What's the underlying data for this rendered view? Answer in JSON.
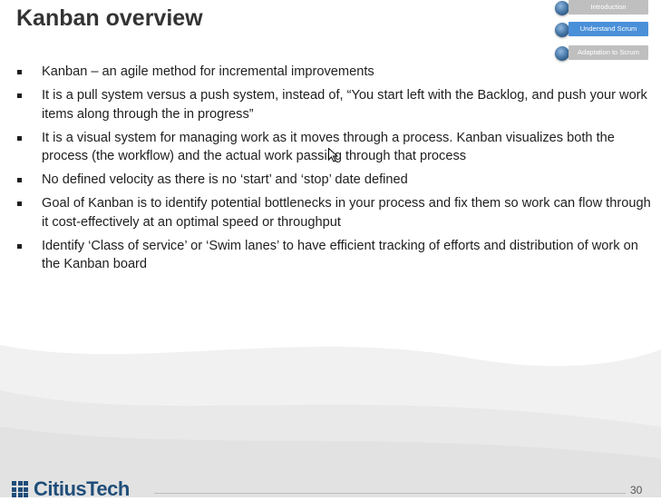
{
  "slide": {
    "title": "Kanban overview",
    "page_number": "30"
  },
  "nav": {
    "items": [
      {
        "label": "Introduction",
        "active": false
      },
      {
        "label": "Understand Scrum",
        "active": true
      },
      {
        "label": "Adaptation to Scrum",
        "active": false
      }
    ]
  },
  "bullets": [
    "Kanban – an agile method for incremental improvements",
    "It is a pull system versus a push system, instead of, “You start left with the Backlog, and push your work items along through the in progress”",
    "It is a visual system for managing work as it moves through a process. Kanban visualizes both the process (the workflow) and the actual work passing through that process",
    "No defined velocity as there is no ‘start’ and ‘stop’ date defined",
    "Goal of Kanban is to identify potential bottlenecks in your process and fix them so work can flow through it cost-effectively at an optimal speed or throughput",
    "Identify ‘Class of service’ or ‘Swim lanes’ to have efficient tracking of efforts and distribution of work on the Kanban board"
  ],
  "logo": {
    "text": "CitiusTech"
  },
  "colors": {
    "accent": "#4a90d9",
    "nav_inactive": "#bfbfbf",
    "logo": "#1f4e79"
  }
}
